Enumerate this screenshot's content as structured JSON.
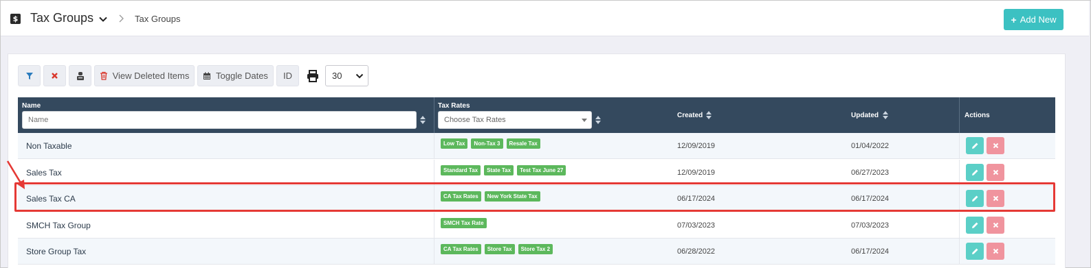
{
  "header": {
    "app_icon_letter": "$",
    "title": "Tax Groups",
    "breadcrumb": "Tax Groups",
    "add_new_label": "Add New"
  },
  "toolbar": {
    "view_deleted_label": "View Deleted Items",
    "toggle_dates_label": "Toggle Dates",
    "id_label": "ID",
    "page_size_value": "30"
  },
  "table": {
    "columns": {
      "name": "Name",
      "tax_rates": "Tax Rates",
      "created": "Created",
      "updated": "Updated",
      "actions": "Actions"
    },
    "filters": {
      "name_placeholder": "Name",
      "tax_rates_placeholder": "Choose Tax Rates"
    },
    "rows": [
      {
        "name": "Non Taxable",
        "tax_rates": [
          "Low Tax",
          "Non-Tax 3",
          "Resale Tax"
        ],
        "created": "12/09/2019",
        "updated": "01/04/2022"
      },
      {
        "name": "Sales Tax",
        "tax_rates": [
          "Standard Tax",
          "State Tax",
          "Test Tax June 27"
        ],
        "created": "12/09/2019",
        "updated": "06/27/2023"
      },
      {
        "name": "Sales Tax CA",
        "tax_rates": [
          "CA Tax Rates",
          "New York State Tax"
        ],
        "created": "06/17/2024",
        "updated": "06/17/2024"
      },
      {
        "name": "SMCH Tax Group",
        "tax_rates": [
          "SMCH Tax Rate"
        ],
        "created": "07/03/2023",
        "updated": "07/03/2023"
      },
      {
        "name": "Store Group Tax",
        "tax_rates": [
          "CA Tax Rates",
          "Store Tax",
          "Store Tax 2"
        ],
        "created": "06/28/2022",
        "updated": "06/17/2024"
      }
    ]
  },
  "colors": {
    "accent": "#3cc1c2",
    "table_header": "#34495e",
    "tag": "#5cb85c",
    "edit": "#5bcfc7",
    "delete": "#f0949e",
    "highlight": "#e53935"
  },
  "icons": [
    "dollar-app-icon",
    "chevron-down-icon",
    "chevron-right-icon",
    "plus-icon",
    "filter-icon",
    "clear-filter-icon",
    "user-icon",
    "trash-icon",
    "calendar-icon",
    "print-icon",
    "sort-icon",
    "pencil-icon",
    "close-icon",
    "arrow-annotation"
  ]
}
